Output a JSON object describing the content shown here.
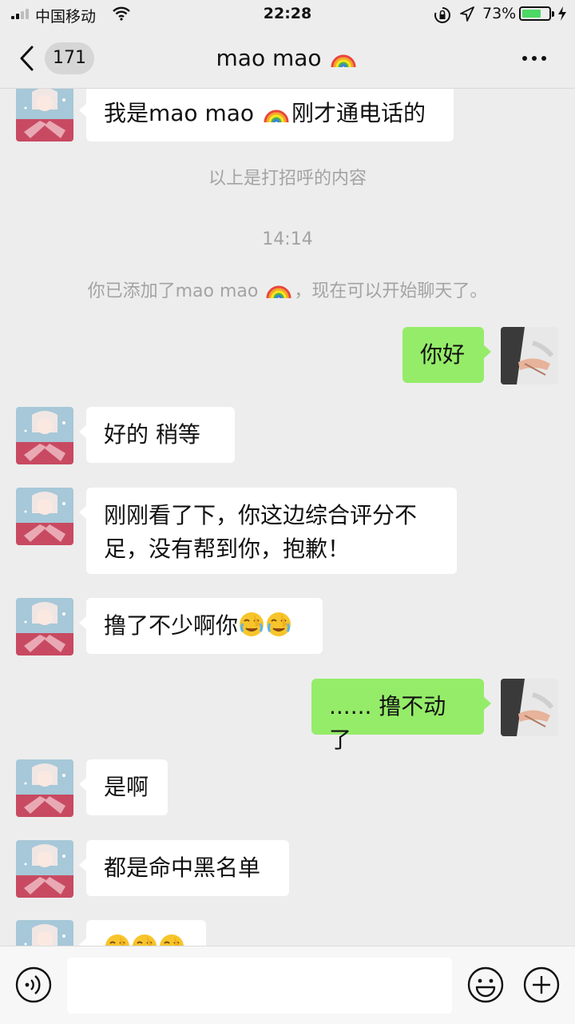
{
  "status_bar": {
    "carrier": "中国移动",
    "time": "22:28",
    "battery_percent": "73%",
    "battery_level": 0.73,
    "signal_bars": 2
  },
  "nav": {
    "unread_count": "171",
    "title": "mao  mao",
    "title_emoji": "rainbow-emoji"
  },
  "messages": [
    {
      "side": "in",
      "text": "我是mao  mao ",
      "emoji": "rainbow-emoji",
      "text_after": "刚才通电话的"
    },
    {
      "side": "system",
      "text": "以上是打招呼的内容"
    },
    {
      "side": "system",
      "text": "14:14"
    },
    {
      "side": "system",
      "text": "你已添加了mao  mao ",
      "emoji": "rainbow-emoji",
      "text_after": "，现在可以开始聊天了。"
    },
    {
      "side": "out",
      "text": "你好"
    },
    {
      "side": "in",
      "text": "好的  稍等"
    },
    {
      "side": "in",
      "text": "刚刚看了下，你这边综合评分不足，没有帮到你，抱歉！"
    },
    {
      "side": "in",
      "text": "撸了不少啊你",
      "emoji": "facepalm-tears-emoji x2"
    },
    {
      "side": "out",
      "text": "...... 撸不动了"
    },
    {
      "side": "in",
      "text": "是啊"
    },
    {
      "side": "in",
      "text": "都是命中黑名单"
    },
    {
      "side": "in",
      "text": "",
      "emoji": "facepalm-tears-emoji x3"
    }
  ],
  "input_bar": {
    "voice_icon": "voice-mode-icon",
    "emoji_icon": "emoji-face-icon",
    "plus_icon": "plus-circle-icon"
  },
  "colors": {
    "background": "#ededed",
    "outgoing_bubble": "#95ec69",
    "incoming_bubble": "#ffffff",
    "system_text": "#a3a3a3",
    "battery_fill": "#4cd964"
  }
}
